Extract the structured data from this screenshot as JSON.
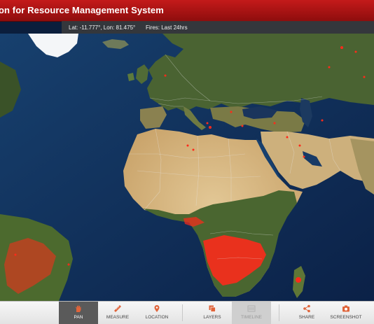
{
  "header": {
    "title": "on for Resource Management System"
  },
  "coords": {
    "lat_lon": "Lat: -11.777°, Lon: 81.475°",
    "fires": "Fires: Last 24hrs"
  },
  "toolbar": {
    "pan": "PAN",
    "measure": "MEASURE",
    "location": "LOCATION",
    "layers": "LAYERS",
    "timeline": "TIMELINE",
    "share": "SHARE",
    "screenshot": "SCREENSHOT"
  },
  "colors": {
    "header": "#b01414",
    "fire": "#ff2a1a",
    "ocean": "#0e2a52",
    "desert": "#d8be8a",
    "forest": "#3f5a28"
  }
}
